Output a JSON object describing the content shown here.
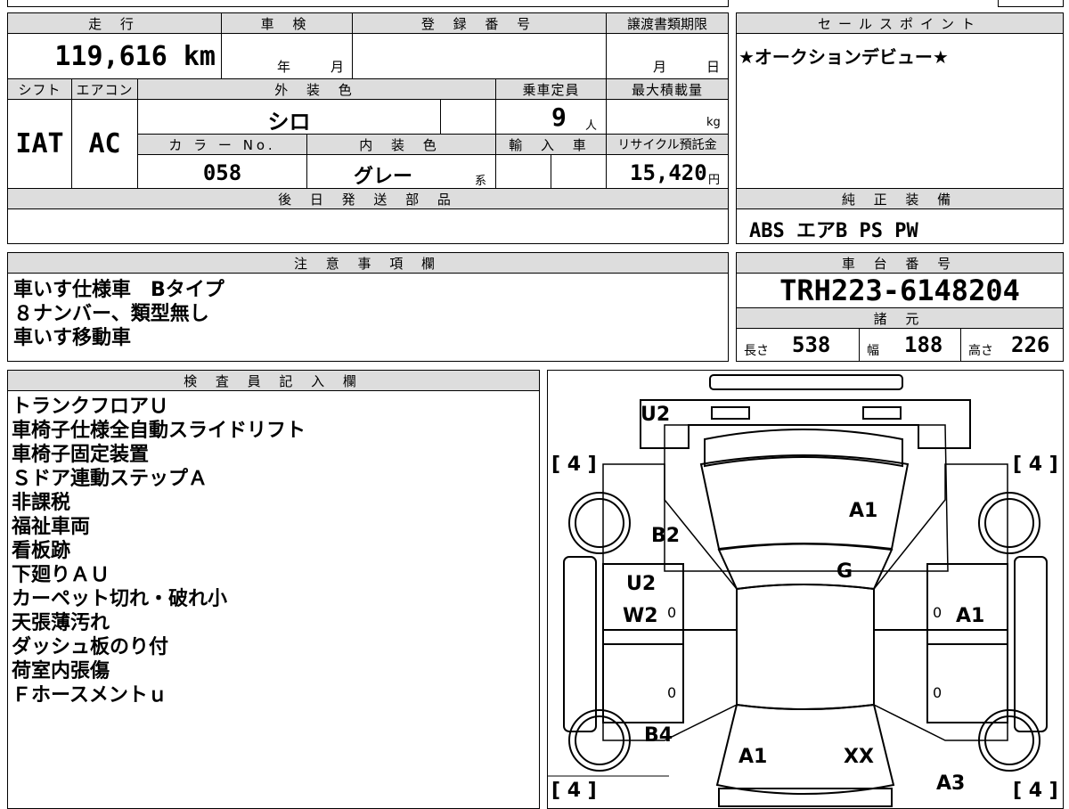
{
  "top_block": {
    "mileage_label": "走 行",
    "mileage_value": "119,616 km",
    "shaken_label": "車 検",
    "shaken_year": "年",
    "shaken_month": "月",
    "reg_label": "登 録 番 号",
    "transfer_label": "譲渡書類期限",
    "transfer_month": "月",
    "transfer_day": "日",
    "shift_label": "シフト",
    "aircon_label": "エアコン",
    "ext_color_label": "外 装 色",
    "capacity_label": "乗車定員",
    "maxload_label": "最大積載量",
    "shift_value": "IAT",
    "aircon_value": "AC",
    "ext_color_value": "シロ",
    "capacity_value": "9",
    "capacity_unit": "人",
    "maxload_unit": "kg",
    "color_no_label": "カ ラ ー No.",
    "int_color_label": "内 装 色",
    "import_label": "輸 入 車",
    "recycle_label": "リサイクル預託金",
    "color_no_value": "058",
    "int_color_value": "グレー",
    "int_color_suffix": "系",
    "recycle_value": "15,420",
    "recycle_unit": "円",
    "later_parts_label": "後 日 発 送 部 品"
  },
  "sales_point": {
    "label": "セールスポイント",
    "text": "★オークションデビュー★"
  },
  "equipment": {
    "label": "純 正 装 備",
    "text": "ABS エアB PS PW"
  },
  "notes": {
    "label": "注 意 事 項 欄",
    "lines": [
      "車いす仕様車　Bタイプ",
      "８ナンバー、類型無し",
      "車いす移動車"
    ]
  },
  "chassis": {
    "label": "車 台 番 号",
    "number": "TRH223-6148204",
    "spec_label": "諸 元",
    "length_label": "長さ",
    "length_value": "538",
    "width_label": "幅",
    "width_value": "188",
    "height_label": "高さ",
    "height_value": "226"
  },
  "inspector": {
    "label": "検 査 員 記 入 欄",
    "lines": [
      "トランクフロアＵ",
      "車椅子仕様全自動スライドリフト",
      "車椅子固定装置",
      "Ｓドア連動ステップＡ",
      "非課税",
      "福祉車両",
      "看板跡",
      "下廻りＡＵ",
      "カーペット切れ・破れ小",
      "天張薄汚れ",
      "ダッシュ板のり付",
      "荷室内張傷",
      "Ｆホースメントｕ"
    ]
  },
  "diagram": {
    "tire_marks": [
      "[ 4 ]",
      "[ 4 ]",
      "[ 4 ]",
      "[ 4 ]"
    ],
    "marks": {
      "rear_top": "U2",
      "roof": "A1",
      "left_rear_quarter": "B2",
      "glass": "G",
      "left_door_1": "U2",
      "left_door_2": "W2",
      "right_door": "A1",
      "left_front_fender": "B4",
      "hood": "A1",
      "hood_right": "XX",
      "right_front": "A3"
    },
    "zeros": [
      "0",
      "0",
      "0",
      "0"
    ]
  }
}
